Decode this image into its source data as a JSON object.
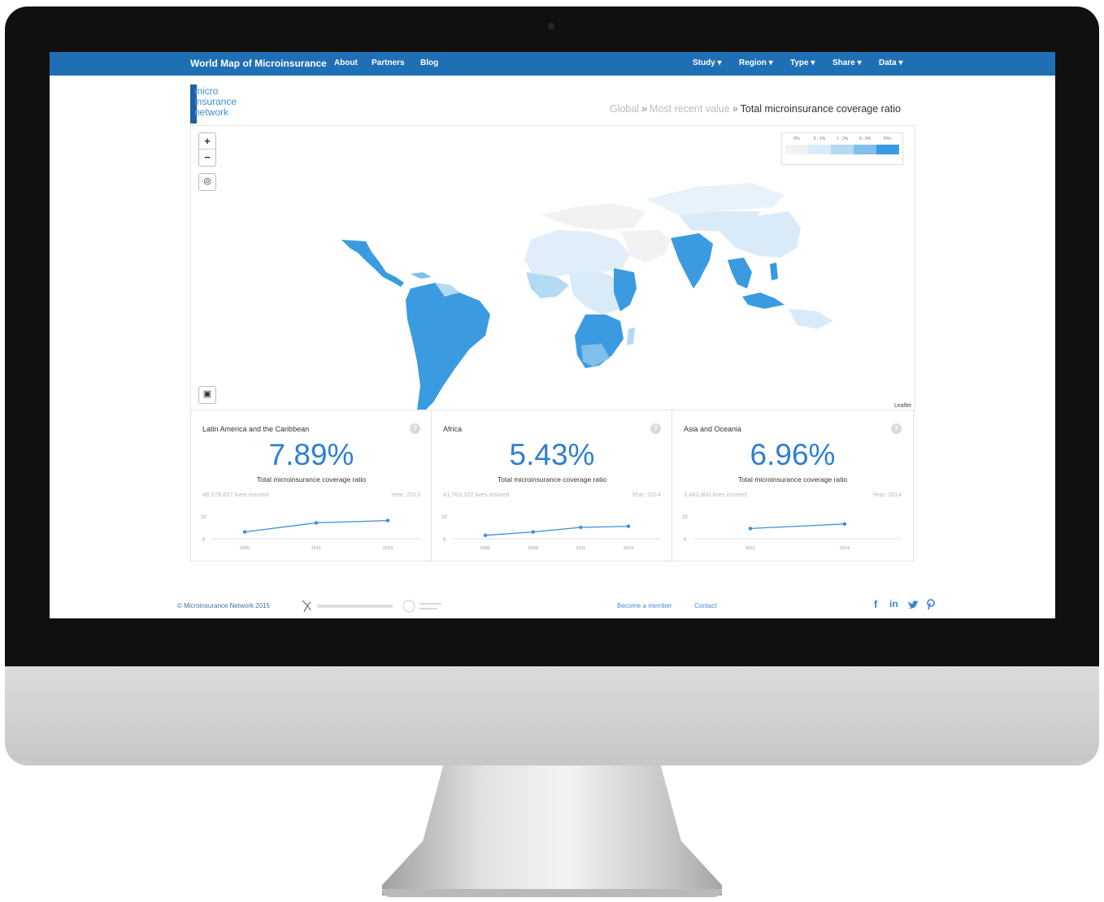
{
  "app": {
    "brand": "World Map of Microinsurance",
    "nav_left": [
      "About",
      "Partners",
      "Blog"
    ],
    "nav_right": [
      "Study ▾",
      "Region ▾",
      "Type ▾",
      "Share ▾",
      "Data ▾"
    ]
  },
  "logo": {
    "lines": [
      "micro",
      "insurance",
      "network"
    ]
  },
  "breadcrumb": {
    "items": [
      "Global",
      "Most recent value",
      "Total microinsurance coverage ratio"
    ],
    "separator": "»"
  },
  "map": {
    "zoom_in": "+",
    "zoom_out": "−",
    "attribution": "Leaflet",
    "legend": {
      "labels": [
        "0%",
        "0 - 1%",
        "1 - 3%",
        "3 - 6%",
        "6%+"
      ],
      "colors": [
        "#f2f2f2",
        "#d9ebf8",
        "#b4d9f3",
        "#7fbfea",
        "#3a9be0"
      ]
    }
  },
  "cards": [
    {
      "title": "Latin America and the Caribbean",
      "value": "7.89%",
      "label": "Total microinsurance coverage ratio",
      "lives": "48,578,827 lives insured",
      "year": "Year: 2013",
      "spark": {
        "years": [
          "2005",
          "2011",
          "2013"
        ],
        "y_labels": [
          "10",
          "0"
        ],
        "values": [
          0.3,
          0.7,
          0.8
        ]
      }
    },
    {
      "title": "Africa",
      "value": "5.43%",
      "label": "Total microinsurance coverage ratio",
      "lives": "61,763,322 lives insured",
      "year": "Year: 2014",
      "spark": {
        "years": [
          "2005",
          "2008",
          "2011",
          "2014"
        ],
        "y_labels": [
          "10",
          "0"
        ],
        "values": [
          0.15,
          0.3,
          0.5,
          0.55
        ]
      }
    },
    {
      "title": "Asia and Oceania",
      "value": "6.96%",
      "label": "Total microinsurance coverage ratio",
      "lives": "3,482,800 lives insured",
      "year": "Year: 2014",
      "spark": {
        "years": [
          "2011",
          "2014"
        ],
        "y_labels": [
          "10",
          "0"
        ],
        "values": [
          0.45,
          0.65
        ]
      }
    }
  ],
  "footer": {
    "copyright": "© Microinsurance Network 2015",
    "links": [
      "Become a member",
      "Contact"
    ],
    "social": [
      "facebook-icon",
      "linkedin-icon",
      "twitter-icon",
      "pinterest-icon"
    ]
  }
}
